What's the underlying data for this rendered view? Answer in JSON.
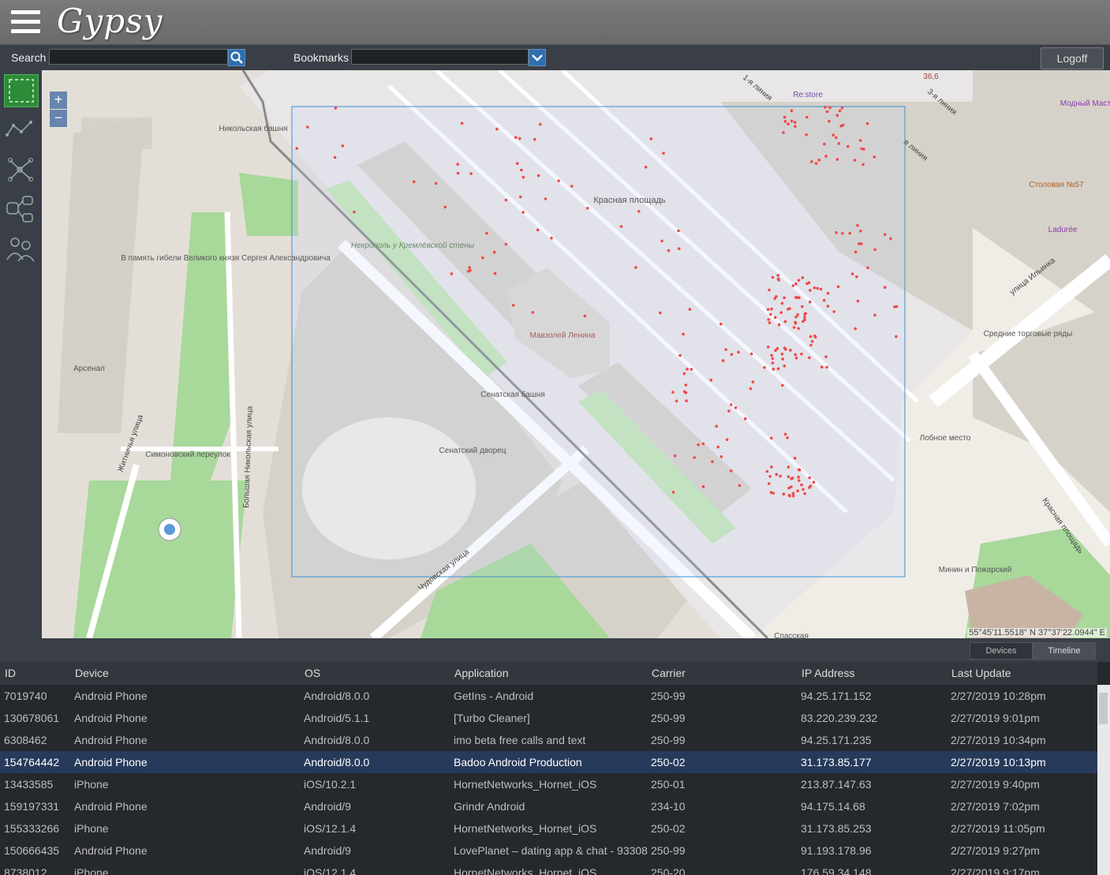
{
  "app": {
    "logo": "Gypsy"
  },
  "searchbar": {
    "search_label": "Search",
    "search_value": "",
    "bookmarks_label": "Bookmarks",
    "bookmarks_value": "",
    "logoff_label": "Logoff"
  },
  "map": {
    "zoom_in": "+",
    "zoom_out": "−",
    "coords": "55°45'11.5518\" N  37°37'22.0944\" E",
    "labels": {
      "nikolskaya": "Никольская башня",
      "red_square": "Красная площадь",
      "necropolis": "Некрополь у Кремлёвской стены",
      "mausoleum": "Мавзолей Ленина",
      "senatskaya": "Сенатская башня",
      "senate": "Сенатский дворец",
      "arsenal": "Арсенал",
      "memory": "В память гибели Великого князя Сергея Александровича",
      "simonovsky": "Симоновский переулок",
      "zhitnichya": "Житничья улица",
      "bolshaya_nik": "Большая Никольская улица",
      "chudovskaya": "Чудовская улица",
      "ilyinka": "улица Ильинка",
      "trade_rows": "Средние торговые ряды",
      "lobnoe": "Лобное место",
      "minin": "Минин и Пожарский",
      "krasnaya_pl_street": "Красная площадь",
      "restore": "Re:store",
      "stolovaya": "Столовая №57",
      "laduree": "Ladurée",
      "modny": "Модный Мастер.ру",
      "line1": "1-я линия",
      "line3": "3-я линия",
      "line3b": "я линия",
      "num366": "36,6",
      "spasskaya": "Спасская"
    }
  },
  "lower": {
    "tab_devices": "Devices",
    "tab_timeline": "Timeline"
  },
  "table": {
    "columns": [
      "ID",
      "Device",
      "OS",
      "Application",
      "Carrier",
      "IP Address",
      "Last Update"
    ],
    "rows": [
      [
        "7019740",
        "Android Phone",
        "Android/8.0.0",
        "GetIns - Android",
        "250-99",
        "94.25.171.152",
        "2/27/2019 10:28pm"
      ],
      [
        "130678061",
        "Android Phone",
        "Android/5.1.1",
        "[Turbo Cleaner]",
        "250-99",
        "83.220.239.232",
        "2/27/2019 9:01pm"
      ],
      [
        "6308462",
        "Android Phone",
        "Android/8.0.0",
        "imo beta free calls and text",
        "250-99",
        "94.25.171.235",
        "2/27/2019 10:34pm"
      ],
      [
        "154764442",
        "Android Phone",
        "Android/8.0.0",
        "Badoo Android Production",
        "250-02",
        "31.173.85.177",
        "2/27/2019 10:13pm"
      ],
      [
        "13433585",
        "iPhone",
        "iOS/10.2.1",
        "HornetNetworks_Hornet_iOS",
        "250-01",
        "213.87.147.63",
        "2/27/2019 9:40pm"
      ],
      [
        "159197331",
        "Android Phone",
        "Android/9",
        "Grindr Android",
        "234-10",
        "94.175.14.68",
        "2/27/2019 7:02pm"
      ],
      [
        "155333266",
        "iPhone",
        "iOS/12.1.4",
        "HornetNetworks_Hornet_iOS",
        "250-02",
        "31.173.85.253",
        "2/27/2019 11:05pm"
      ],
      [
        "150666435",
        "Android Phone",
        "Android/9",
        "LovePlanet – dating app & chat - 93308",
        "250-99",
        "91.193.178.96",
        "2/27/2019 9:27pm"
      ],
      [
        "8738012",
        "iPhone",
        "iOS/12.1.4",
        "HornetNetworks_Hornet_iOS",
        "250-20",
        "176.59.34.148",
        "2/27/2019 9:17pm"
      ]
    ],
    "selected_row": 3
  },
  "colors": {
    "accent": "#2e6fb0",
    "selected_row": "#273a5a",
    "tool_selected": "#2e8b3a",
    "point": "#f04848"
  }
}
